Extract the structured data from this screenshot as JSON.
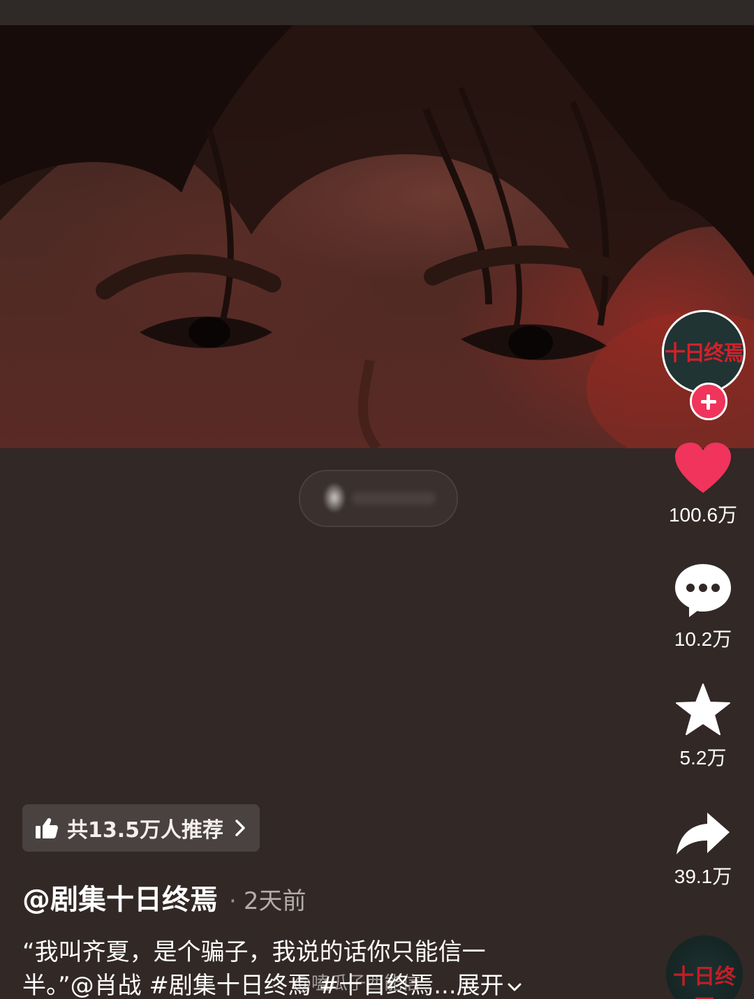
{
  "video": {
    "paused_indicator": ""
  },
  "author": {
    "avatar_logo": "十日终焉",
    "name": "@剧集十日终焉",
    "separator": "·",
    "posted": "2天前"
  },
  "actions": {
    "likes": "100.6万",
    "comments": "10.2万",
    "favorites": "5.2万",
    "shares": "39.1万"
  },
  "recommend": {
    "label": "共13.5万人推荐"
  },
  "caption": {
    "line1": "“我叫齐夏，是个骗子，我说的话你只能信一",
    "line2": "半。”@肖战 #剧集十日终焉 #十日终焉...",
    "expand_label": "展开"
  },
  "watermark": {
    "text": "@嗑瓜子西能信"
  },
  "music_disc": {
    "logo": "十日终焉"
  },
  "colors": {
    "like_red": "#f0345b",
    "follow_red": "#f0345b",
    "background": "#322826"
  },
  "icons": {
    "like": "heart-icon",
    "comment": "comment-bubble-icon",
    "favorite": "star-icon",
    "share": "share-arrow-icon",
    "recommend": "thumbs-up-icon",
    "follow": "plus-icon"
  }
}
